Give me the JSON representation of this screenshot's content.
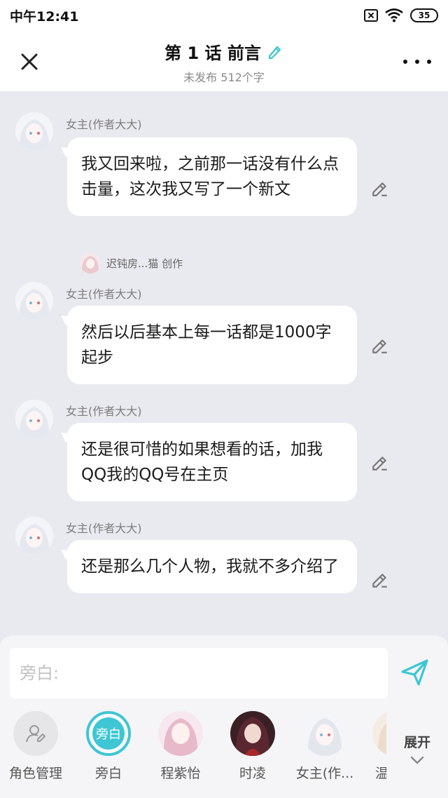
{
  "status": {
    "time": "中午12:41",
    "battery": "35"
  },
  "header": {
    "title": "第 1 话 前言",
    "subtitle": "未发布 512个字"
  },
  "messages": [
    {
      "speaker": "女主(作者大大)",
      "text": "我又回来啦，之前那一话没有什么点击量，这次我又写了一个新文"
    },
    {
      "speaker": "女主(作者大大)",
      "text": "然后以后基本上每一话都是1000字起步"
    },
    {
      "speaker": "女主(作者大大)",
      "text": "还是很可惜的如果想看的话，加我QQ我的QQ号在主页"
    },
    {
      "speaker": "女主(作者大大)",
      "text": "还是那么几个人物，我就不多介绍了"
    }
  ],
  "creator": {
    "text": "迟钝房...猫 创作"
  },
  "input": {
    "placeholder": "旁白:"
  },
  "characters": [
    {
      "label": "角色管理"
    },
    {
      "label": "旁白",
      "badge": "旁白"
    },
    {
      "label": "程紫怡"
    },
    {
      "label": "时凌"
    },
    {
      "label": "女主(作..."
    },
    {
      "label": "温"
    }
  ],
  "expand_label": "展开",
  "colors": {
    "accent": "#3ec6d4",
    "background": "#e9eaef"
  }
}
